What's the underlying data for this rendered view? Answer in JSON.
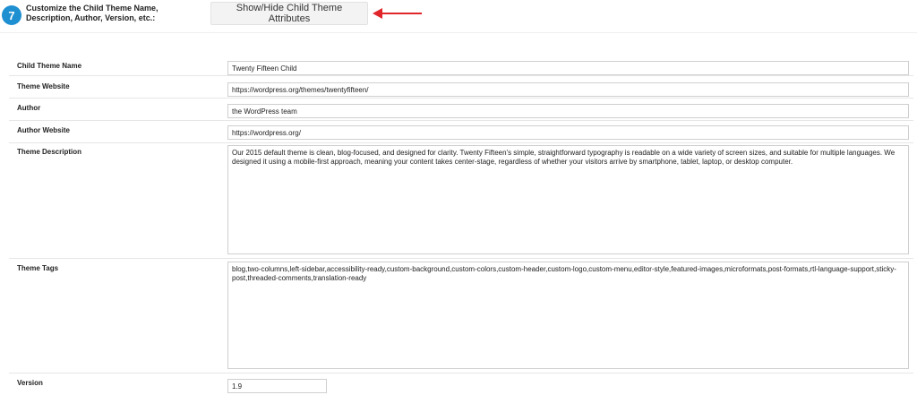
{
  "step": {
    "number": "7",
    "text": "Customize the Child Theme Name, Description, Author, Version, etc.:"
  },
  "toggle_button": {
    "label": "Show/Hide Child Theme Attributes"
  },
  "fields": {
    "child_theme_name": {
      "label": "Child Theme Name",
      "value": "Twenty Fifteen Child"
    },
    "theme_website": {
      "label": "Theme Website",
      "value": "https://wordpress.org/themes/twentyfifteen/"
    },
    "author": {
      "label": "Author",
      "value": "the WordPress team"
    },
    "author_website": {
      "label": "Author Website",
      "value": "https://wordpress.org/"
    },
    "theme_description": {
      "label": "Theme Description",
      "value": "Our 2015 default theme is clean, blog-focused, and designed for clarity. Twenty Fifteen's simple, straightforward typography is readable on a wide variety of screen sizes, and suitable for multiple languages. We designed it using a mobile-first approach, meaning your content takes center-stage, regardless of whether your visitors arrive by smartphone, tablet, laptop, or desktop computer."
    },
    "theme_tags": {
      "label": "Theme Tags",
      "value": "blog,two-columns,left-sidebar,accessibility-ready,custom-background,custom-colors,custom-header,custom-logo,custom-menu,editor-style,featured-images,microformats,post-formats,rtl-language-support,sticky-post,threaded-comments,translation-ready"
    },
    "version": {
      "label": "Version",
      "value": "1.9"
    }
  },
  "colors": {
    "badge": "#1e8fd0",
    "arrow": "#e0252b"
  },
  "icons": {
    "arrow": "left-arrow-icon"
  }
}
